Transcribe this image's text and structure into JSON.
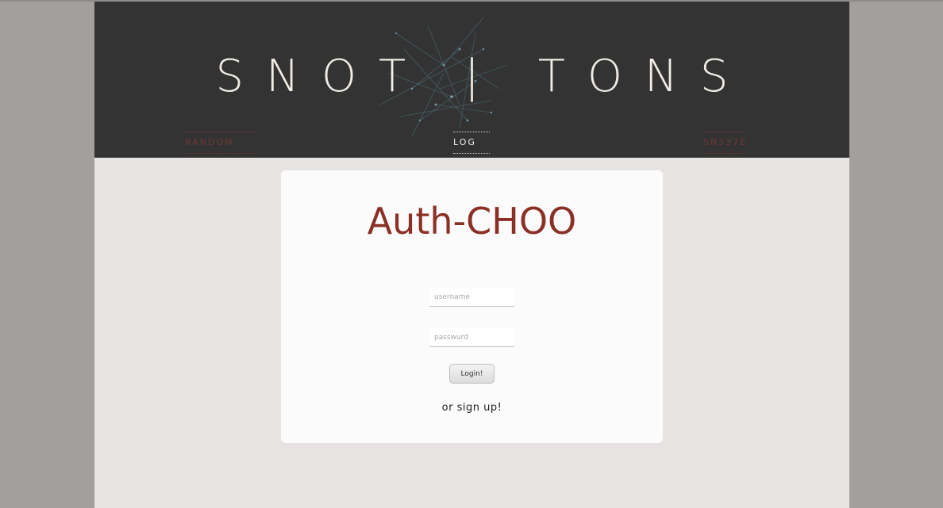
{
  "header": {
    "brand": "SNOT | TONS",
    "nav": {
      "left_label": "RANDOM DICK",
      "center_label": "LOG IN",
      "right_label": "SN337E"
    }
  },
  "login_card": {
    "title": "Auth-CHOO",
    "username_placeholder": "username",
    "password_placeholder": "passwurd",
    "login_button": "Login!",
    "signup_link": "or sign up!"
  },
  "colors": {
    "header_bg": "#333333",
    "accent": "#8b3025",
    "page_bg": "#e7e3e2",
    "outer_bg": "#a39f9d"
  }
}
